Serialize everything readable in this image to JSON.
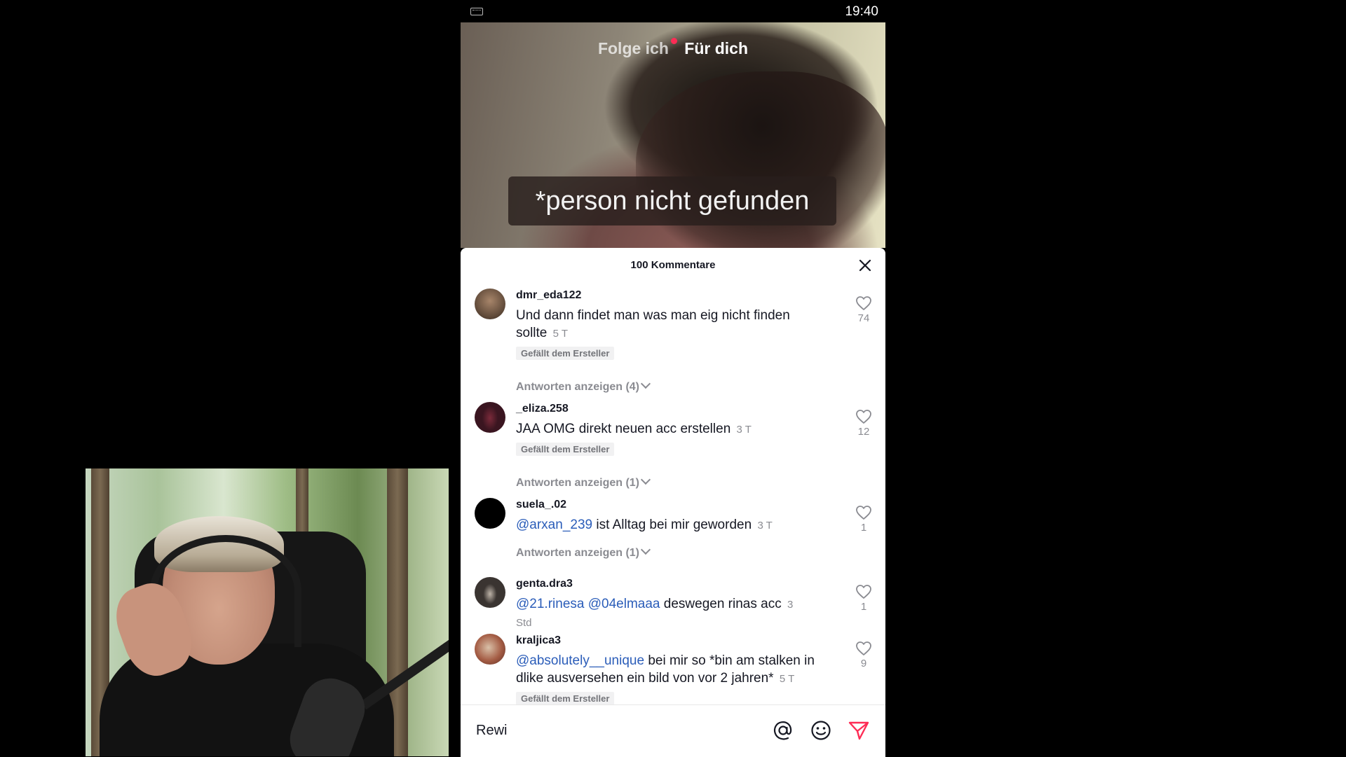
{
  "status_bar": {
    "time": "19:40",
    "left_icon": "keyboard-icon"
  },
  "video": {
    "tabs": [
      {
        "label": "Folge ich",
        "active": false,
        "has_notification_dot": true
      },
      {
        "label": "Für dich",
        "active": true
      }
    ],
    "caption": "*person nicht gefunden"
  },
  "comments_sheet": {
    "title": "100 Kommentare",
    "close_icon": "close-icon",
    "comments": [
      {
        "username": "dmr_eda122",
        "text": "Und dann findet man was man eig nicht finden sollte",
        "mentions": [],
        "time": "5 T",
        "badge": "Gefällt dem Ersteller",
        "likes": "74",
        "replies": "Antworten anzeigen (4)"
      },
      {
        "username": "_eliza.258",
        "text": "JAA OMG direkt neuen acc erstellen",
        "mentions": [],
        "time": "3 T",
        "badge": "Gefällt dem Ersteller",
        "likes": "12",
        "replies": "Antworten anzeigen (1)"
      },
      {
        "username": "suela_.02",
        "text": "ist Alltag bei mir geworden",
        "mentions": [
          "@arxan_239"
        ],
        "time": "3 T",
        "badge": "",
        "likes": "1",
        "replies": "Antworten anzeigen (1)"
      },
      {
        "username": "genta.dra3",
        "text": "deswegen rinas acc",
        "mentions": [
          "@21.rinesa",
          "@04elmaaa"
        ],
        "time": "3 Std",
        "badge": "",
        "likes": "1",
        "replies": ""
      },
      {
        "username": "kraljica3",
        "text": "bei mir so *bin am stalken in dlike ausversehen ein bild von vor 2 jahren*",
        "mentions": [
          "@absolutely__unique"
        ],
        "time": "5 T",
        "badge": "Gefällt dem Ersteller",
        "likes": "9",
        "replies": ""
      }
    ]
  },
  "input_bar": {
    "value": "Rewi",
    "icons": [
      "at-icon",
      "emoji-icon",
      "send-icon"
    ]
  },
  "colors": {
    "mention": "#2b5db9",
    "notification_dot": "#fe2c55",
    "send": "#fe2c55",
    "muted_text": "#8a8b91"
  }
}
